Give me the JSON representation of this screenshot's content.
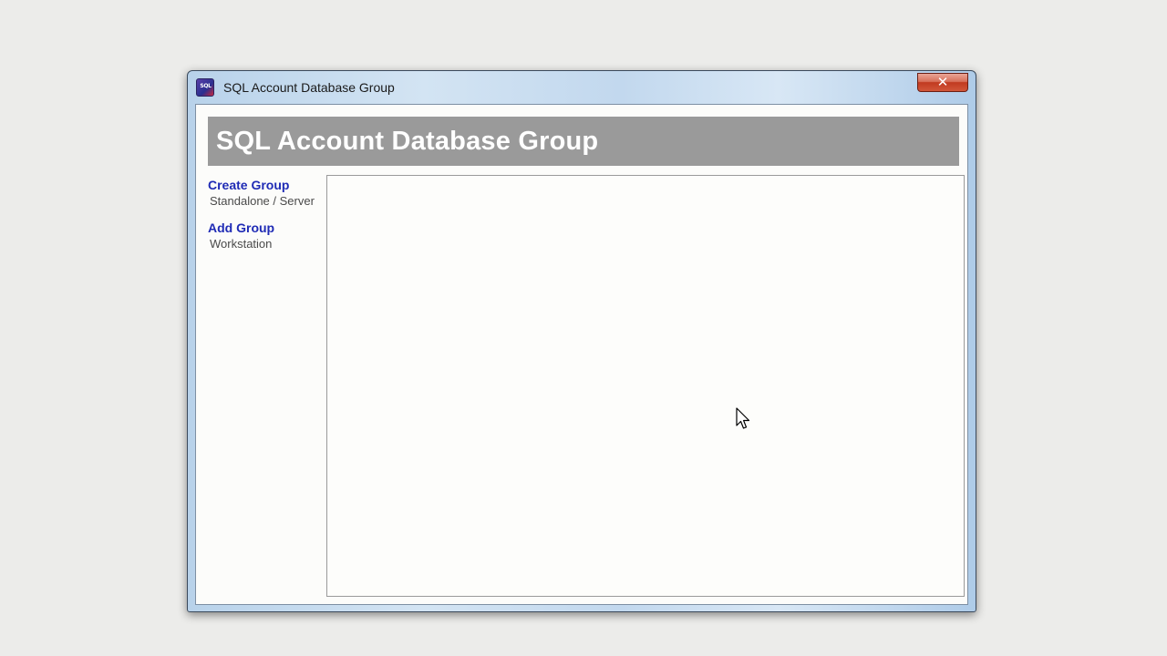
{
  "window": {
    "title": "SQL Account Database Group",
    "icon": "sql-account-app-icon",
    "icon_text": "SQL",
    "close_symbol": "✕"
  },
  "header": {
    "title": "SQL Account Database Group"
  },
  "sidebar": {
    "items": [
      {
        "label": "Create Group",
        "sub": "Standalone / Server"
      },
      {
        "label": "Add Group",
        "sub": "Workstation"
      }
    ]
  },
  "colors": {
    "header_banner": "#9a9a9a",
    "nav_link": "#1f2bb5",
    "close_button": "#c13a20"
  }
}
